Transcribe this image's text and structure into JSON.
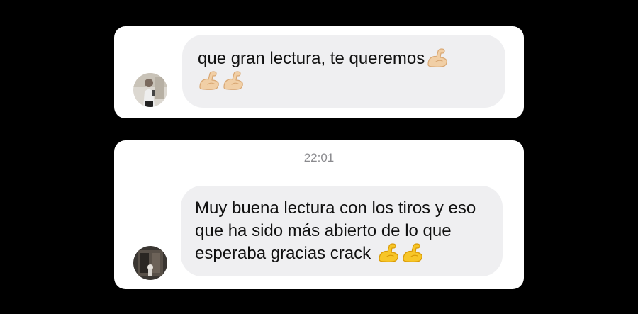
{
  "conversation": {
    "messages": [
      {
        "text": "que gran lectura, te queremos",
        "emoji_count": 3,
        "emoji_icon": "flexed-biceps-icon",
        "emoji_color": "#f1cfa6",
        "emoji_outline": "#d9a874",
        "avatar_icon": "profile-photo-icon"
      },
      {
        "timestamp": "22:01",
        "text": "Muy buena lectura con los tiros y eso que ha sido más abierto de lo que esperaba gracias crack",
        "emoji_count": 2,
        "emoji_icon": "flexed-biceps-icon",
        "emoji_color": "#f7c628",
        "emoji_outline": "#d99a06",
        "avatar_icon": "profile-photo-icon"
      }
    ]
  },
  "colors": {
    "background": "#000000",
    "card": "#ffffff",
    "bubble": "#efeff1",
    "timestamp": "#8a8a8e"
  }
}
